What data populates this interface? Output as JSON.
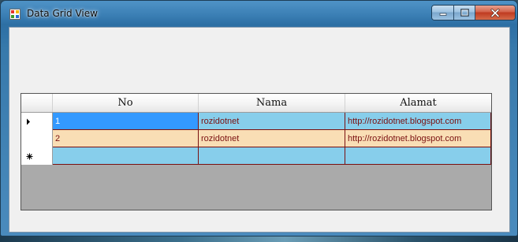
{
  "window": {
    "title": "Data Grid View",
    "icon": "app-form-icon",
    "caption_buttons": [
      "minimize-icon",
      "maximize-icon",
      "close-icon"
    ]
  },
  "grid": {
    "columns": [
      "No",
      "Nama",
      "Alamat"
    ],
    "rows": [
      {
        "no": "1",
        "nama": "rozidotnet",
        "alamat": "http://rozidotnet.blogspot.com",
        "indicator": "current-row-arrow-icon"
      },
      {
        "no": "2",
        "nama": "rozidotnet",
        "alamat": "http://rozidotnet.blogspot.com",
        "indicator": ""
      }
    ],
    "new_row_indicator": "new-row-asterisk-icon"
  },
  "colors": {
    "row_blue": "#87ceeb",
    "row_orange": "#f9deb5",
    "selection": "#3399ff",
    "cell_text": "#7a1010",
    "grid_background": "#aaaaaa"
  }
}
